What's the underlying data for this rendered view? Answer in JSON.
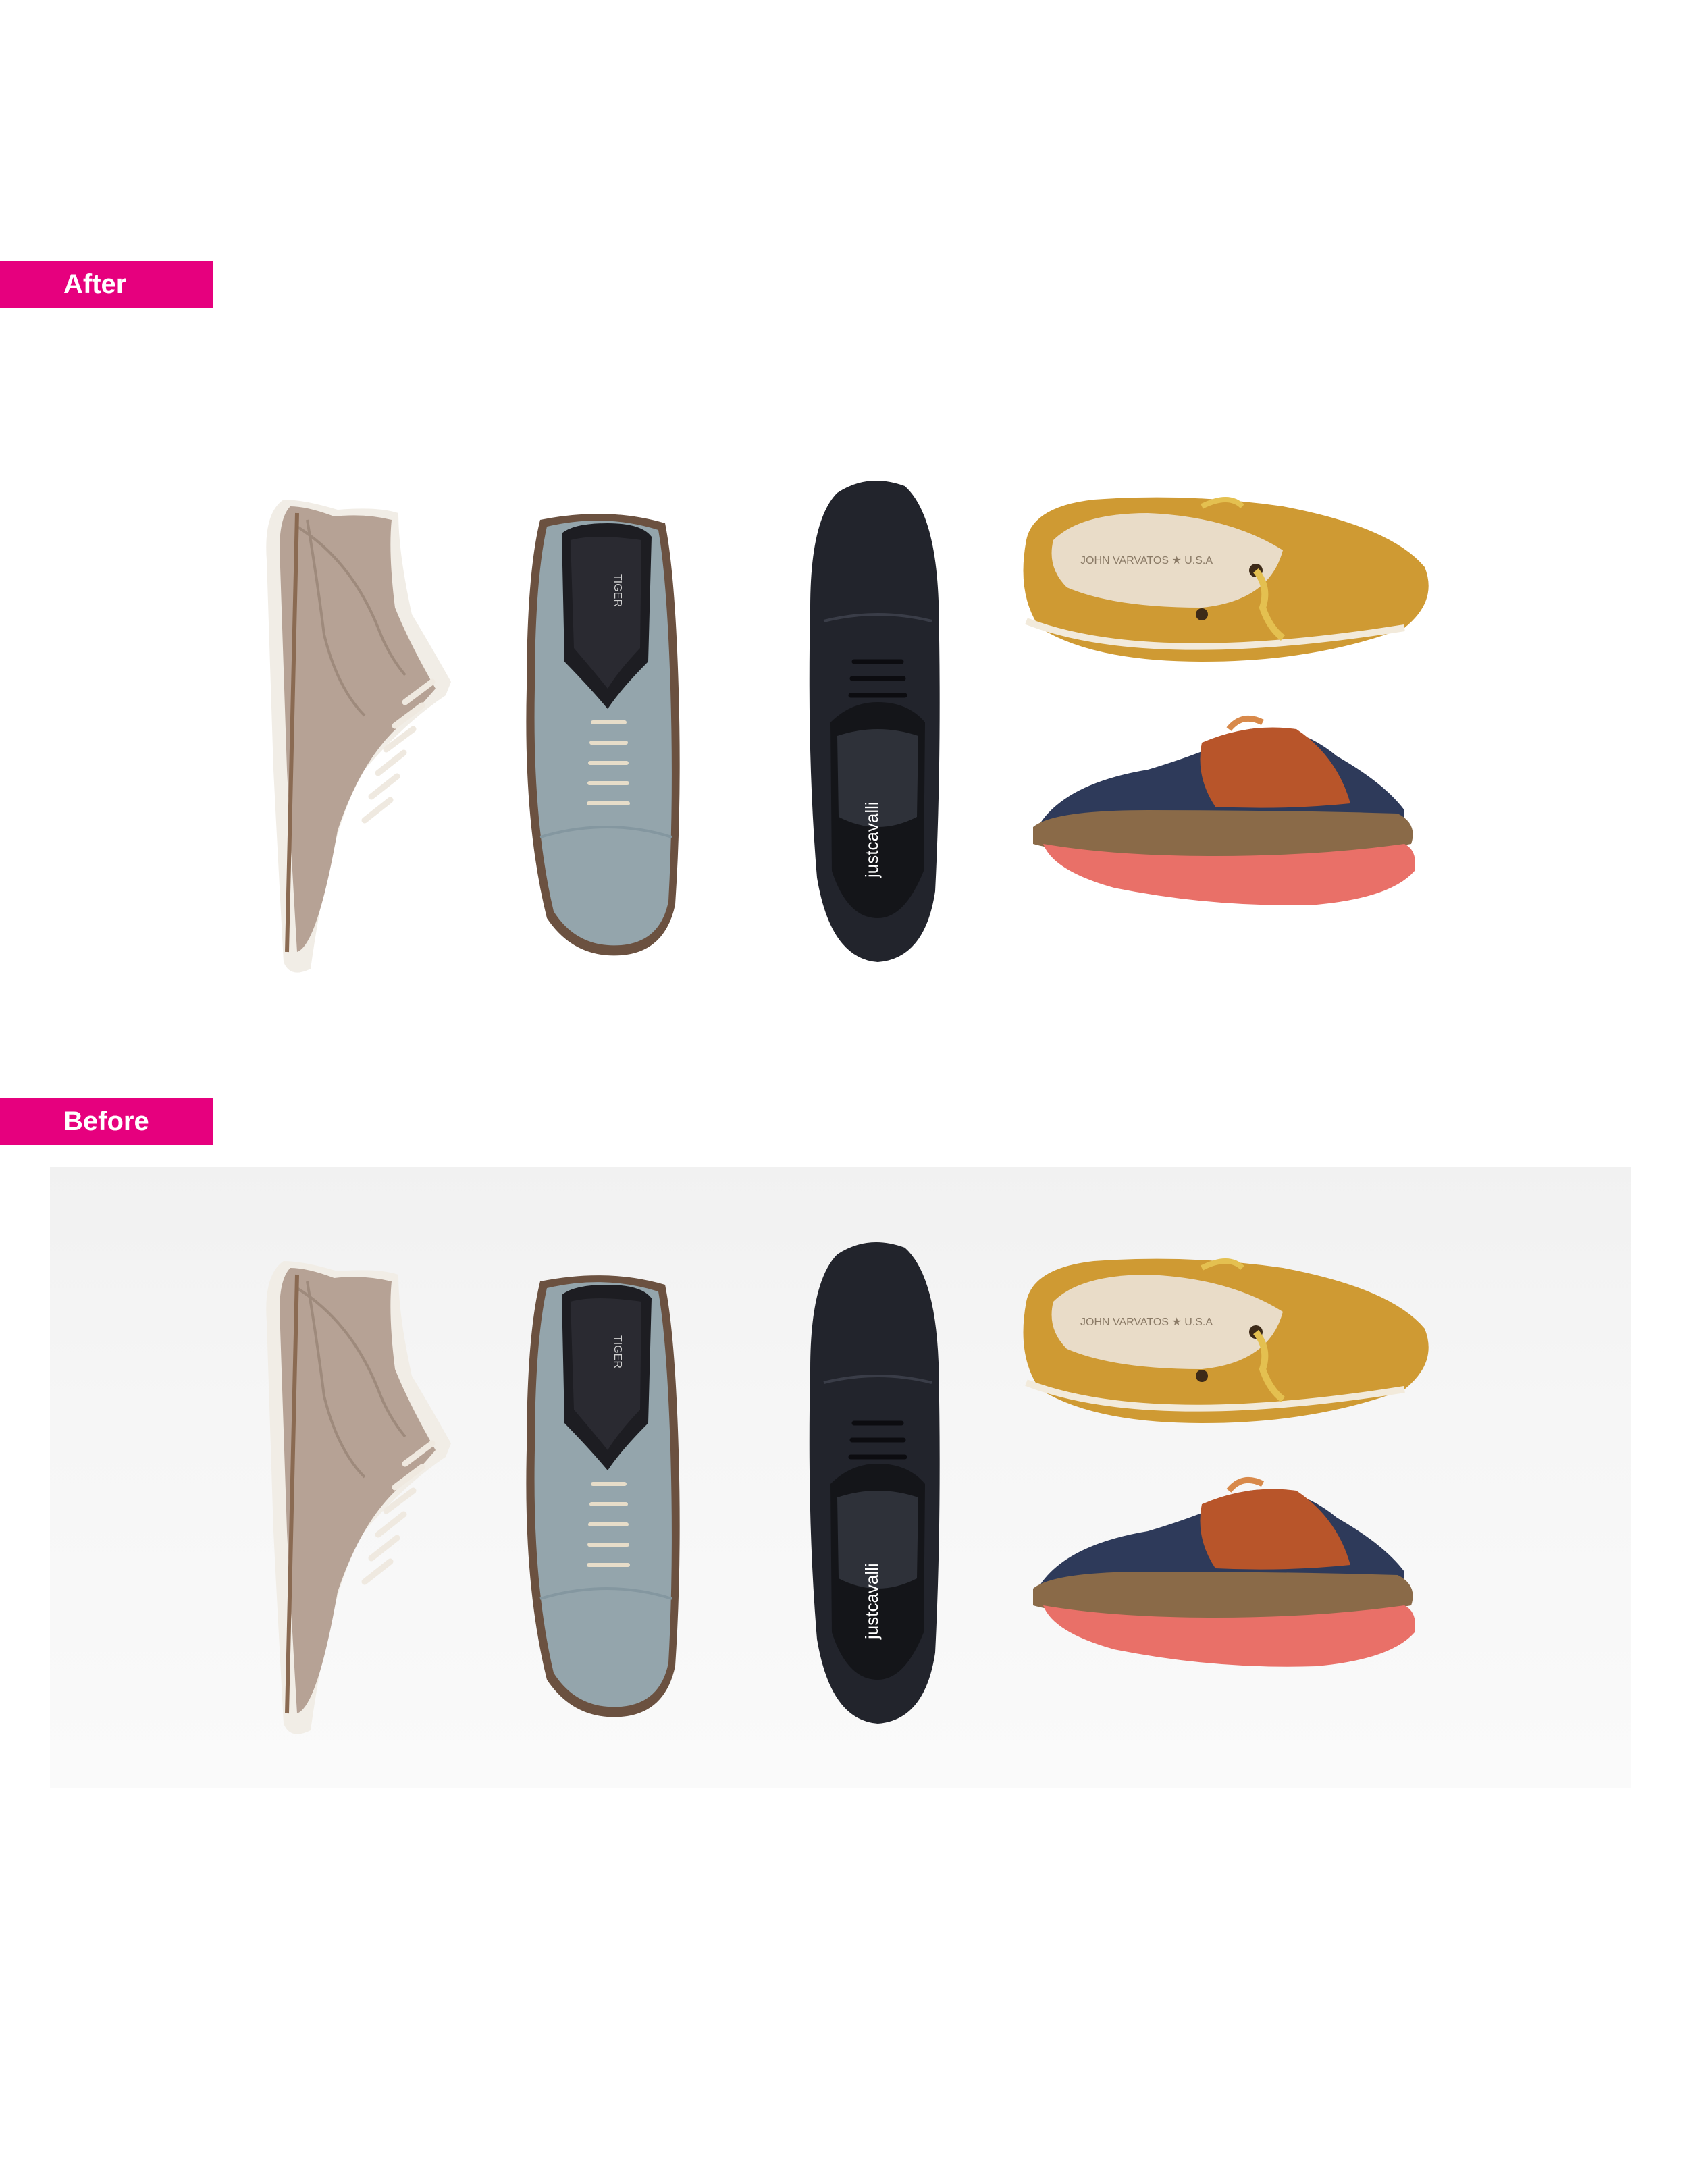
{
  "labels": {
    "after": "After",
    "before": "Before"
  },
  "colors": {
    "tag": "#e6007e",
    "taupe_suede": "#b6a295",
    "grey_blue_suede": "#94a5ac",
    "black_leather": "#22242c",
    "tan_suede": "#cf9a33",
    "navy_canvas": "#2e3a5a",
    "rust_suede": "#b8552a",
    "coral_sole": "#e97068"
  },
  "shoes": {
    "grey_insole_brand": "TIGER",
    "black_insole_brand": "justcavalli",
    "tan_insole_brand": "JOHN VARVATOS ★ U.S.A"
  }
}
